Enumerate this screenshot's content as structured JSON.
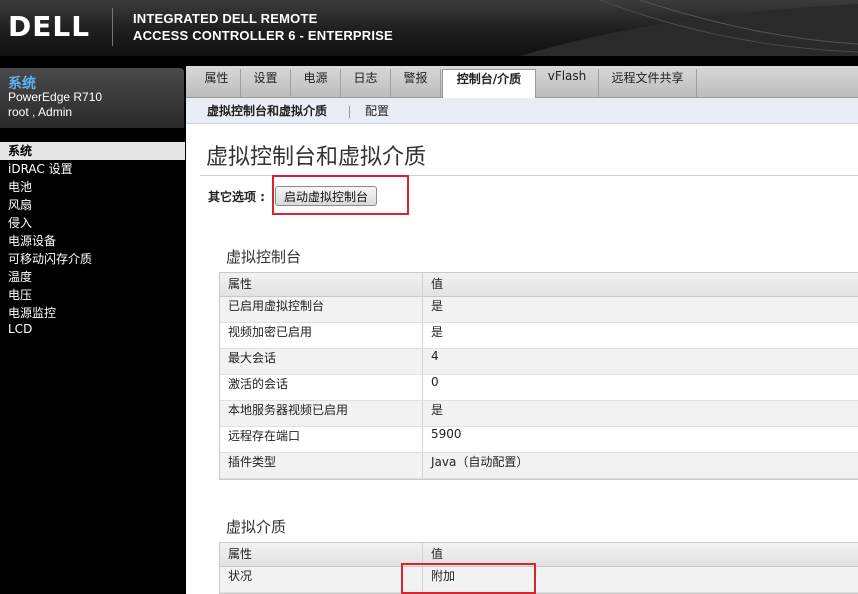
{
  "header": {
    "logo_text": "DELL",
    "product_line1": "INTEGRATED DELL REMOTE",
    "product_line2": "ACCESS CONTROLLER 6 - ENTERPRISE"
  },
  "sidebar": {
    "system_title": "系统",
    "model": "PowerEdge R710",
    "user": "root , Admin",
    "items": [
      {
        "label": "系统"
      },
      {
        "label": "iDRAC 设置"
      },
      {
        "label": "电池"
      },
      {
        "label": "风扇"
      },
      {
        "label": "侵入"
      },
      {
        "label": "电源设备"
      },
      {
        "label": "可移动闪存介质"
      },
      {
        "label": "温度"
      },
      {
        "label": "电压"
      },
      {
        "label": "电源监控"
      },
      {
        "label": "LCD"
      }
    ]
  },
  "tabs": [
    {
      "label": "属性"
    },
    {
      "label": "设置"
    },
    {
      "label": "电源"
    },
    {
      "label": "日志"
    },
    {
      "label": "警报"
    },
    {
      "label": "控制台/介质"
    },
    {
      "label": "vFlash"
    },
    {
      "label": "远程文件共享"
    }
  ],
  "subtabs": [
    {
      "label": "虚拟控制台和虚拟介质"
    },
    {
      "label": "配置"
    }
  ],
  "page": {
    "title": "虚拟控制台和虚拟介质",
    "other_options_label": "其它选项 :",
    "launch_button": "启动虚拟控制台"
  },
  "console_section": {
    "title": "虚拟控制台",
    "headers": [
      "属性",
      "值"
    ],
    "rows": [
      [
        "已启用虚拟控制台",
        "是"
      ],
      [
        "视频加密已启用",
        "是"
      ],
      [
        "最大会话",
        "4"
      ],
      [
        "激活的会话",
        "0"
      ],
      [
        "本地服务器视频已启用",
        "是"
      ],
      [
        "远程存在端口",
        "5900"
      ],
      [
        "插件类型",
        "Java（自动配置）"
      ]
    ]
  },
  "media_section": {
    "title": "虚拟介质",
    "headers": [
      "属性",
      "值"
    ],
    "rows": [
      [
        "状况",
        "附加"
      ]
    ]
  },
  "colors": {
    "highlight": "#d9232e",
    "system_title": "#5fb0f0"
  }
}
